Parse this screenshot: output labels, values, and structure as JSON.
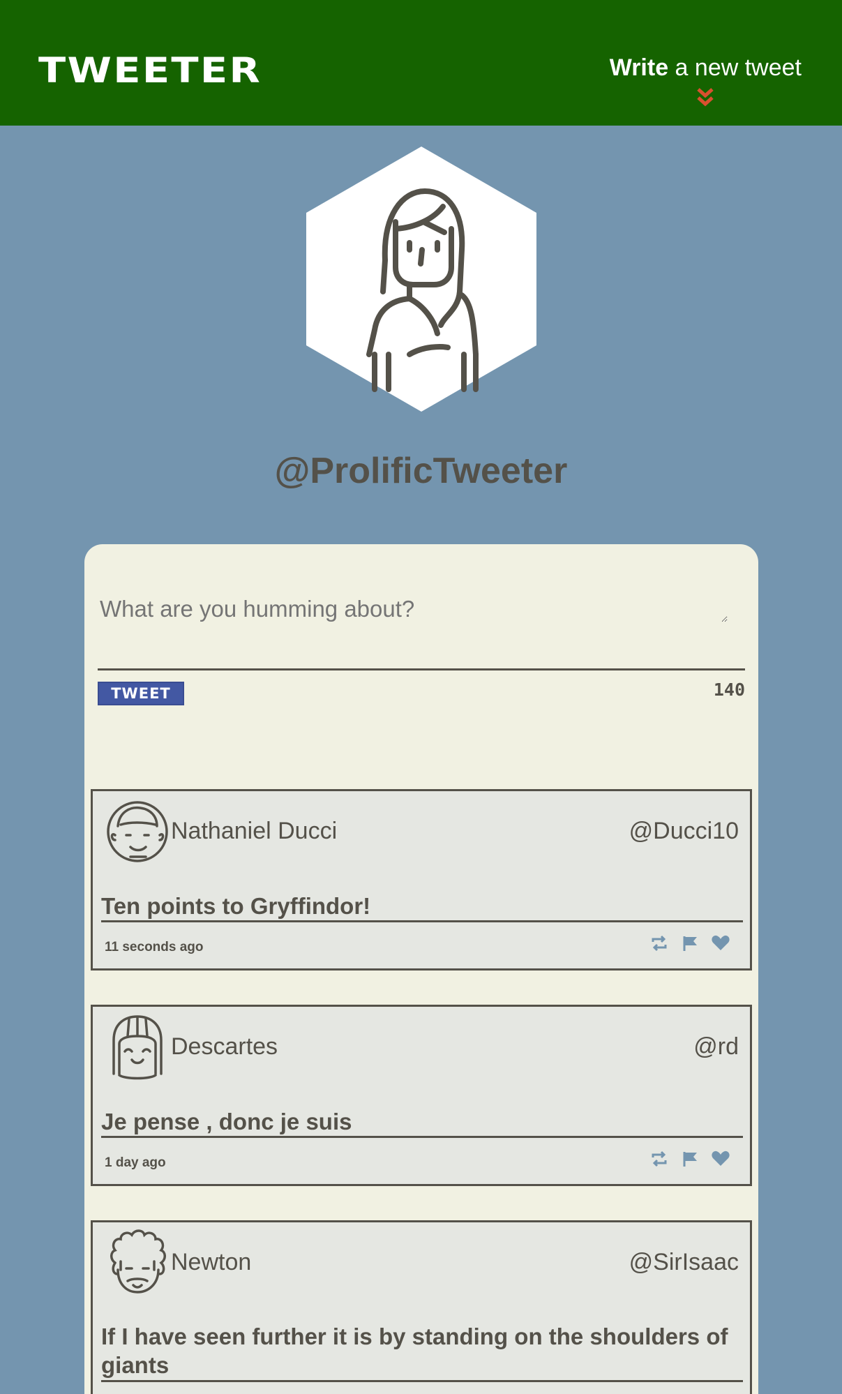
{
  "app": {
    "brand": "TWEETER",
    "compose_toggle_bold": "Write",
    "compose_toggle_rest": " a new tweet",
    "accent": "#156300",
    "chevron_color": "#d9502f"
  },
  "profile": {
    "handle": "@ProlificTweeter"
  },
  "composer": {
    "placeholder": "What are you humming about?",
    "button_label": "TWEET",
    "counter": "140"
  },
  "tweets": [
    {
      "name": "Nathaniel Ducci",
      "handle": "@Ducci10",
      "content": "Ten points to Gryffindor!",
      "time": "11 seconds ago"
    },
    {
      "name": "Descartes",
      "handle": "@rd",
      "content": "Je pense , donc je suis",
      "time": "1 day ago"
    },
    {
      "name": "Newton",
      "handle": "@SirIsaac",
      "content": "If I have seen further it is by standing on the shoulders of giants",
      "time": ""
    }
  ],
  "icons": {
    "retweet": "retweet-icon",
    "flag": "flag-icon",
    "heart": "heart-icon",
    "chevron": "chevron-down-icon"
  }
}
